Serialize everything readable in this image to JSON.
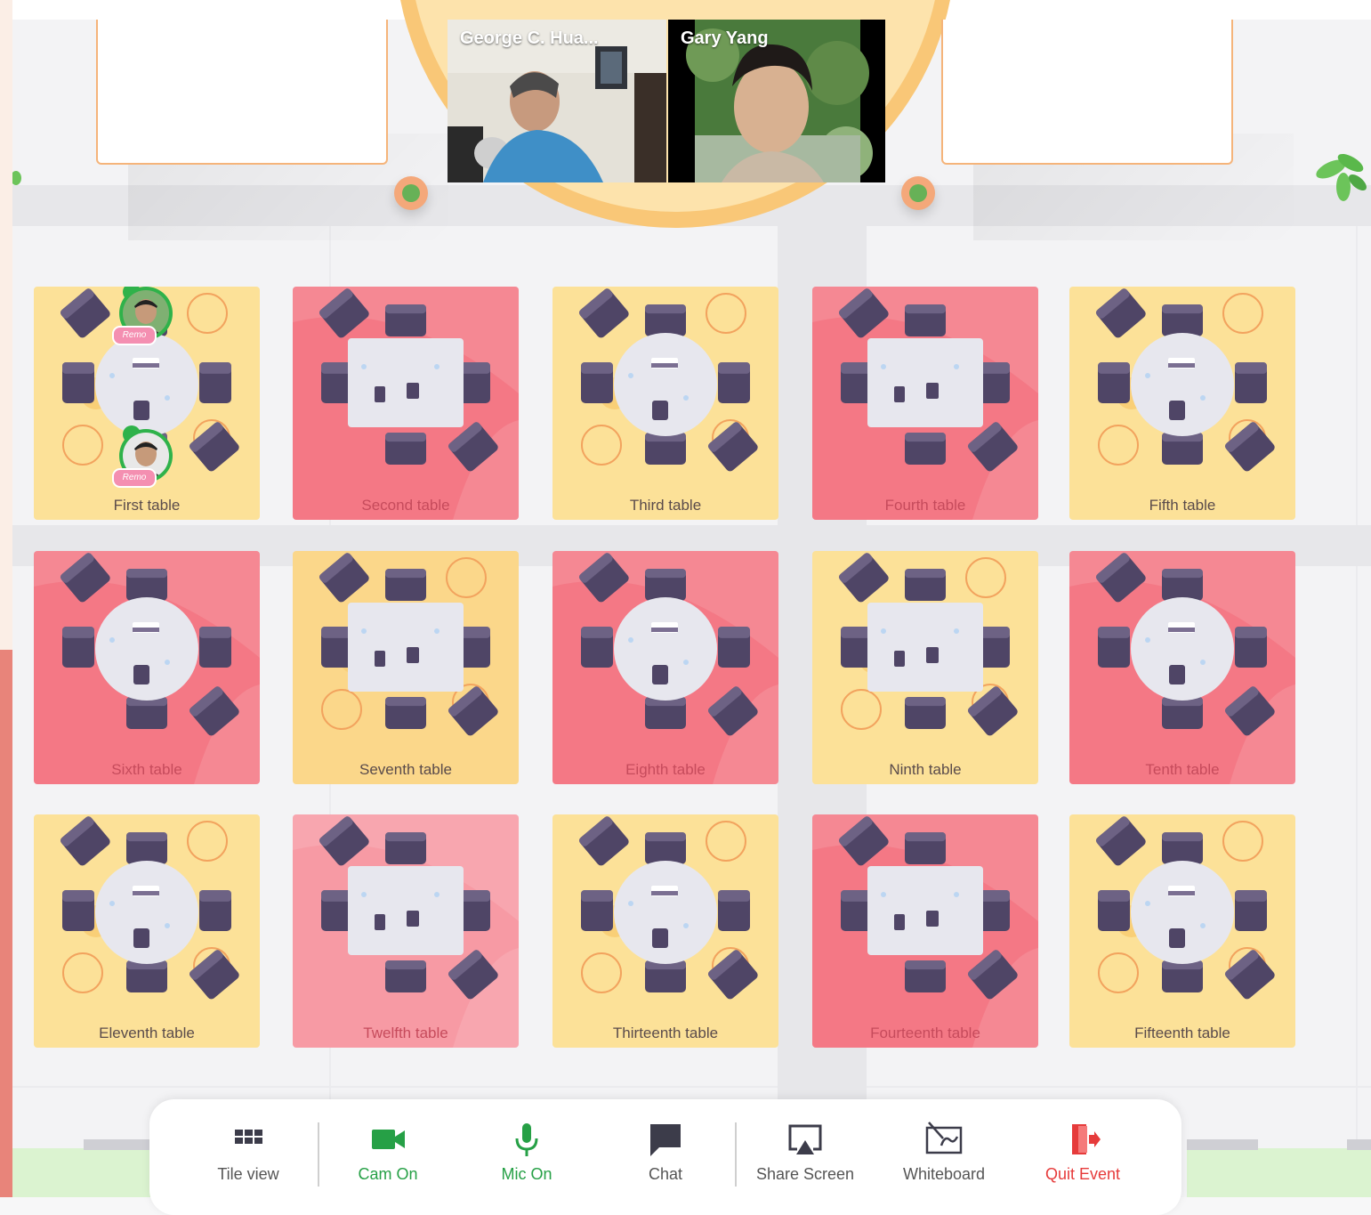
{
  "videos": [
    {
      "name": "George C. Hua..."
    },
    {
      "name": "Gary Yang"
    }
  ],
  "tables": [
    {
      "label": "First table",
      "shape": "round",
      "color": "yellow"
    },
    {
      "label": "Second table",
      "shape": "square",
      "color": "pink"
    },
    {
      "label": "Third table",
      "shape": "round",
      "color": "yellow"
    },
    {
      "label": "Fourth table",
      "shape": "square",
      "color": "pink"
    },
    {
      "label": "Fifth table",
      "shape": "round",
      "color": "yellow"
    },
    {
      "label": "Sixth table",
      "shape": "round",
      "color": "pink"
    },
    {
      "label": "Seventh table",
      "shape": "square",
      "color": "orange"
    },
    {
      "label": "Eighth table",
      "shape": "round",
      "color": "pink"
    },
    {
      "label": "Ninth table",
      "shape": "square",
      "color": "yellow"
    },
    {
      "label": "Tenth table",
      "shape": "round",
      "color": "pink"
    },
    {
      "label": "Eleventh table",
      "shape": "round",
      "color": "yellow"
    },
    {
      "label": "Twelfth table",
      "shape": "square",
      "color": "pinklight"
    },
    {
      "label": "Thirteenth table",
      "shape": "round",
      "color": "yellow"
    },
    {
      "label": "Fourteenth table",
      "shape": "square",
      "color": "pink"
    },
    {
      "label": "Fifteenth table",
      "shape": "round",
      "color": "yellow"
    }
  ],
  "attendee_tag": "Remo",
  "toolbar": {
    "tile_view": "Tile view",
    "cam_on": "Cam On",
    "mic_on": "Mic On",
    "chat": "Chat",
    "share_screen": "Share Screen",
    "whiteboard": "Whiteboard",
    "quit_event": "Quit Event"
  },
  "colors": {
    "active_green": "#26a046",
    "quit_red": "#e63b3b",
    "table_yellow": "#fce198",
    "table_pink": "#f47885",
    "chair_purple": "#4f4566"
  }
}
